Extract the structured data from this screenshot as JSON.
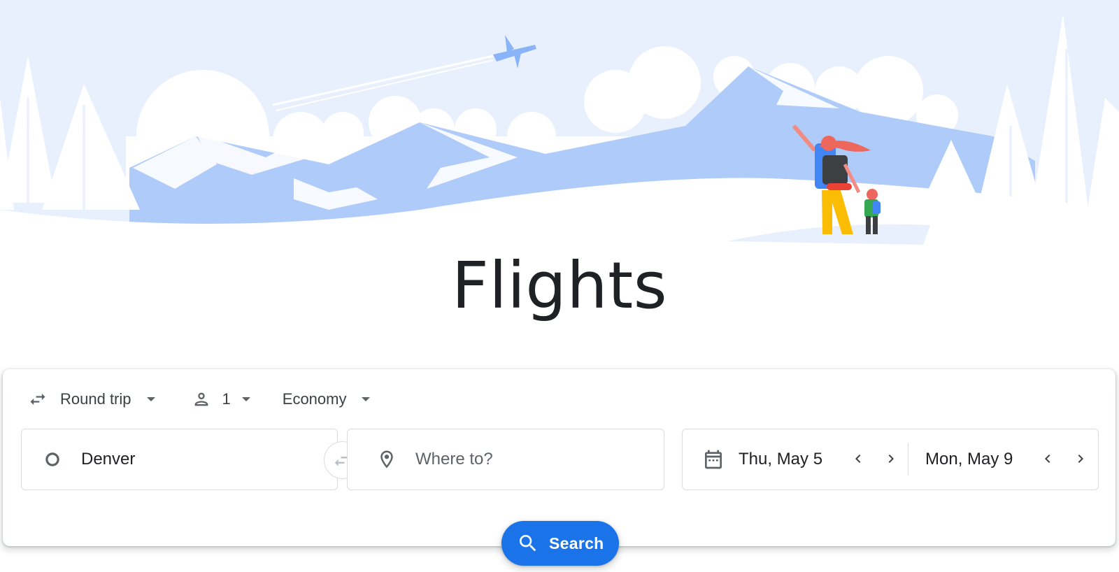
{
  "page": {
    "title": "Flights"
  },
  "trip_options": {
    "trip_type": "Round trip",
    "passengers": "1",
    "cabin_class": "Economy"
  },
  "origin": {
    "value": "Denver"
  },
  "destination": {
    "placeholder": "Where to?"
  },
  "dates": {
    "departure": "Thu, May 5",
    "return": "Mon, May 9"
  },
  "search_button": {
    "label": "Search"
  },
  "colors": {
    "primary": "#1a73e8",
    "hero_sky": "#e8f0fe",
    "hero_mountain": "#aecbfa",
    "text": "#202124",
    "muted_icon": "#5f6368"
  },
  "icons": [
    "swap-arrows-icon",
    "person-icon",
    "caret-down-icon",
    "origin-circle-icon",
    "swap-icon",
    "location-pin-icon",
    "calendar-icon",
    "chevron-left-icon",
    "chevron-right-icon",
    "search-icon",
    "airplane-icon"
  ]
}
